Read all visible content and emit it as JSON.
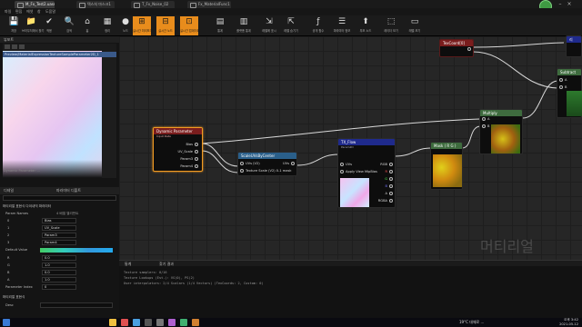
{
  "tabs": [
    "M_Fx_Test2.uasset",
    "텍스처 마스크1",
    "T_Fx_Noise_02",
    "Fx_MaterialFunc1"
  ],
  "menu": [
    "파일",
    "편집",
    "에셋",
    "창",
    "도움말"
  ],
  "toolbar": [
    {
      "label": "저장",
      "icon": "💾"
    },
    {
      "label": "브라우저에서 찾기",
      "icon": "📁"
    },
    {
      "label": "적용",
      "icon": "✔"
    },
    {
      "label": "검색",
      "icon": "🔍"
    },
    {
      "label": "홈",
      "icon": "⌂"
    },
    {
      "label": "정리",
      "icon": "▦"
    },
    {
      "label": "노드",
      "icon": "●"
    },
    {
      "label": "실시간 미리보기",
      "icon": "⊞"
    },
    {
      "label": "실시간 노드",
      "icon": "⊟"
    },
    {
      "label": "실시간 업데이트",
      "icon": "⊡"
    },
    {
      "label": "통계",
      "icon": "▤"
    },
    {
      "label": "플랫폼 통계",
      "icon": "▥"
    },
    {
      "label": "레벨에 표시",
      "icon": "⇲"
    },
    {
      "label": "레벨 숨기기",
      "icon": "⇱"
    },
    {
      "label": "공개 함수",
      "icon": "ƒ"
    },
    {
      "label": "파라미터 정보",
      "icon": "☰"
    },
    {
      "label": "부모 노드",
      "icon": "⬆"
    },
    {
      "label": "셰이더 보기",
      "icon": "⬚"
    },
    {
      "label": "레벨 보기",
      "icon": "▭"
    }
  ],
  "viewport": {
    "title": "뷰포트",
    "path": "Preview/MaterialExpressionTextureSampleParameter2D_1",
    "overlay": "Dynamic Parameter: ..."
  },
  "details": {
    "title": "디테일",
    "tab2": "파라미터 디폴트",
    "section": "머티리얼 표현식 다이내믹 파라미터",
    "param_names_label": "Param Names",
    "param_names": [
      "Bias",
      "UV_Scale",
      "Param3",
      "Param4"
    ],
    "default_label": "Default Value",
    "defaults": [
      {
        "k": "R",
        "v": "0.0"
      },
      {
        "k": "G",
        "v": "1.0"
      },
      {
        "k": "B",
        "v": "0.0"
      },
      {
        "k": "A",
        "v": "1.0"
      }
    ],
    "param_index_label": "Parameter Index",
    "param_index": "0",
    "section2": "머티리얼 표현식",
    "desc_label": "Desc",
    "entries_label": "4 배열 엘리먼트"
  },
  "nodes": {
    "dynparam": {
      "title": "Dynamic Parameter",
      "sub": "Input Data",
      "pins": [
        "Bias",
        "UV_Scale",
        "Param3",
        "Param4"
      ]
    },
    "scaleuv": {
      "title": "ScaleUVsByCenter",
      "inputs": [
        "UVs (V2)",
        "Texture Scale (V2) 0-1 mask"
      ],
      "output": "UVs"
    },
    "txflow": {
      "title": "TX_Flow",
      "sub": "Param2D",
      "inputs": [
        "UVs",
        "Apply View MipBias"
      ],
      "outputs": [
        "RGB",
        "R",
        "G",
        "B",
        "A",
        "RGBA"
      ]
    },
    "mask": {
      "title": "Mask ( R G )"
    },
    "multiply": {
      "title": "Multiply",
      "pins": [
        "A",
        "B"
      ]
    },
    "texcoord": {
      "title": "TexCoord[0]"
    },
    "subtract": {
      "title": "Subtract",
      "pins": [
        "A",
        "B"
      ]
    },
    "right_top": {
      "title": "리"
    }
  },
  "watermark": "머티리얼",
  "log": {
    "tab1": "통계",
    "tab2": "찾기 결과",
    "lines": [
      "Texture samplers: 0/16",
      "Texture Lookups (Est.): VS(0), PS(2)",
      "User interpolators: 2/4 Scalars (1/4 Vectors) (TexCoords: 2, Custom: 0)"
    ]
  },
  "taskbar": {
    "weather": "19°C 대체로 ...",
    "time": "오후 3:42",
    "date": "2021-05-12"
  }
}
